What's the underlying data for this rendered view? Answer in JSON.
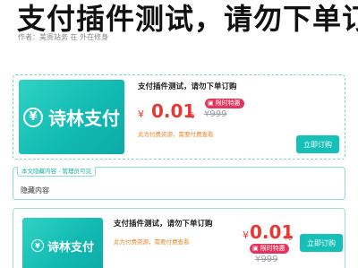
{
  "article": {
    "title": "支付插件测试，请勿下单订购",
    "meta": "作者：美贵站务 在 外在修身"
  },
  "card1": {
    "logo_text": "诗林支付",
    "logo_symbol": "¥",
    "product_title": "支付插件测试，请勿下单订购",
    "currency": "¥",
    "price": "0.01",
    "unit": "元",
    "badge_icon": "gift-icon",
    "badge_label": "限时特惠",
    "original_price": "¥999",
    "note": "此为付费资源，需要付费查看",
    "buy_label": "立即订购"
  },
  "hidden": {
    "tag": "本文隐藏内容 - 管理员可见",
    "content": "隐藏内容"
  },
  "card2": {
    "logo_text": "诗林支付",
    "logo_symbol": "¥",
    "product_title": "支付插件测试，请勿下单订购",
    "note": "此为付费资源，需要付费查看",
    "currency": "¥",
    "price": "0.01",
    "unit": "元",
    "badge_label": "限时特惠",
    "original_price": "¥999",
    "buy_label": "立即订购"
  },
  "colors": {
    "accent": "#14c0b7",
    "price": "#e53935",
    "badge": "#e5345c",
    "note": "#e8862b"
  }
}
